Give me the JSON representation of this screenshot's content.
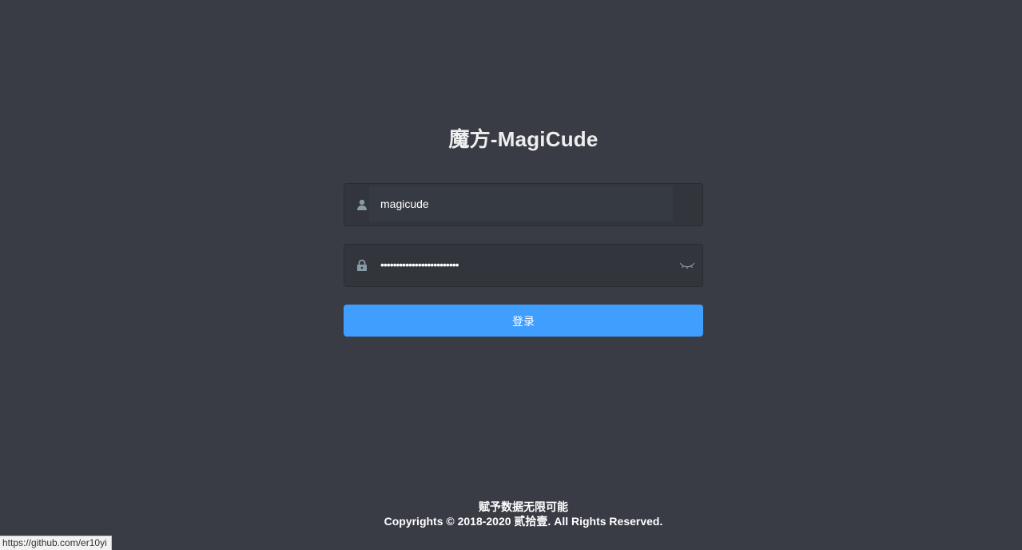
{
  "title": "魔方-MagiCude",
  "form": {
    "username_value": "magicude",
    "password_value": "•••••••••••••••••••••••••",
    "login_label": "登录"
  },
  "icons": {
    "username": "user-icon",
    "password": "lock-icon",
    "toggle_password": "eye-closed-icon"
  },
  "footer": {
    "slogan": "赋予数据无限可能",
    "copyright": "Copyrights © 2018-2020 贰拾壹. All Rights Reserved."
  },
  "statusbar": {
    "url": "https://github.com/er10yi"
  },
  "colors": {
    "background": "#393c45",
    "input_background": "#32353b",
    "primary": "#409eff"
  }
}
